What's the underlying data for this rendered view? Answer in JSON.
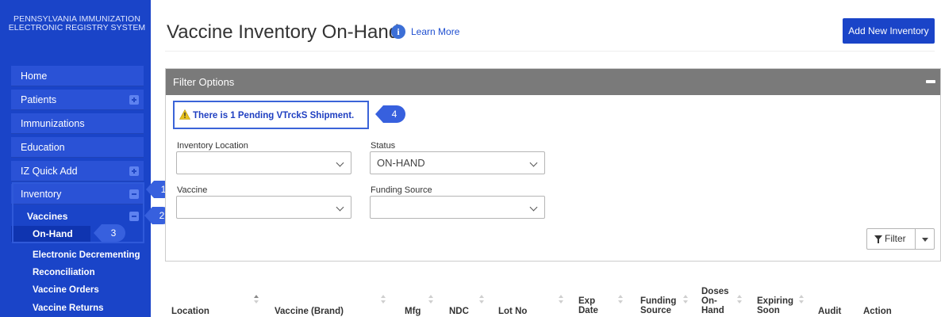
{
  "sidebar": {
    "brand_line1": "PENNSYLVANIA IMMUNIZATION",
    "brand_line2": "ELECTRONIC REGISTRY SYSTEM",
    "items": [
      {
        "label": "Home"
      },
      {
        "label": "Patients"
      },
      {
        "label": "Immunizations"
      },
      {
        "label": "Education"
      },
      {
        "label": "IZ Quick Add"
      },
      {
        "label": "Inventory"
      }
    ],
    "inventory_sub": {
      "vaccines": "Vaccines",
      "on_hand": "On-Hand",
      "electronic_decrementing": "Electronic Decrementing",
      "reconciliation": "Reconciliation",
      "vaccine_orders": "Vaccine Orders",
      "vaccine_returns": "Vaccine Returns"
    }
  },
  "callouts": [
    "1",
    "2",
    "3",
    "4"
  ],
  "header": {
    "title": "Vaccine Inventory On-Hand",
    "info_glyph": "i",
    "learn_more": "Learn More",
    "add_button": "Add New Inventory"
  },
  "filter_panel": {
    "title": "Filter Options",
    "alert": "There is 1 Pending VTrckS Shipment.",
    "fields": {
      "inventory_location": {
        "label": "Inventory Location",
        "value": ""
      },
      "status": {
        "label": "Status",
        "value": "ON-HAND"
      },
      "vaccine": {
        "label": "Vaccine",
        "value": ""
      },
      "funding_source": {
        "label": "Funding Source",
        "value": ""
      }
    },
    "filter_button": "Filter"
  },
  "table": {
    "headers": {
      "location": "Location",
      "vaccine_brand": "Vaccine (Brand)",
      "mfg": "Mfg",
      "ndc": "NDC",
      "lot_no": "Lot No",
      "exp_date_1": "Exp",
      "exp_date_2": "Date",
      "funding_1": "Funding",
      "funding_2": "Source",
      "doses_1": "Doses",
      "doses_2": "On-",
      "doses_3": "Hand",
      "expiring_1": "Expiring",
      "expiring_2": "Soon",
      "audit": "Audit",
      "action": "Action"
    }
  },
  "colors": {
    "sidebar": "#1a44c8",
    "sidebar_item": "#2a52d6",
    "panel_header": "#7a7a7a",
    "accent": "#1a44c8",
    "callout": "#3760de"
  }
}
